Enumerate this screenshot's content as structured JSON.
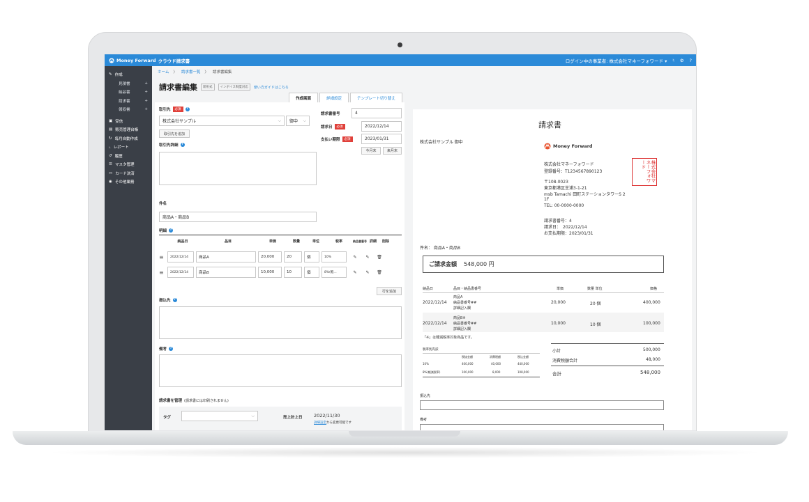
{
  "app": {
    "brand": "Money Forward",
    "product": "クラウド請求書",
    "login_user": "ログイン中の事業者: 株式会社マネーフォワード ▾"
  },
  "sidebar": {
    "create": "作成",
    "subs": [
      "見積書",
      "納品書",
      "請求書",
      "領収書"
    ],
    "items": [
      "受信",
      "販売管理台帳",
      "毎月自動作成",
      "レポート",
      "履歴",
      "マスタ管理",
      "カード決済",
      "その他業務"
    ]
  },
  "breadcrumb": [
    "ホーム",
    "請求書一覧",
    "請求書編集"
  ],
  "page": {
    "title": "請求書編集",
    "tag1": "新形式",
    "tag2": "インボイス制度対応",
    "guide": "使い方ガイドはこちら"
  },
  "tabs": [
    "作成画面",
    "詳細設定",
    "テンプレート切り替え"
  ],
  "form": {
    "customer_label": "取引先",
    "required": "必須",
    "customer_value": "株式会社サンプル",
    "honorific": "御中",
    "add_customer": "取引先を追加",
    "customer_detail_label": "取引先詳細",
    "invoice_no_label": "請求書番号",
    "invoice_no": "4",
    "date_label": "請求日",
    "date": "2022/12/14",
    "due_label": "支払い期限",
    "due": "2023/01/31",
    "this_month_end": "今月末",
    "next_month_end": "来月末",
    "subject_label": "件名",
    "subject": "商品A・商品B",
    "details_label": "明細",
    "bank_label": "振込先",
    "memo_label": "備考",
    "add_row": "行を追加",
    "manage_label": "請求書を管理",
    "manage_note": "(請求書には印刷されません)",
    "tag_label": "タグ",
    "sales_date_label": "売上計上日",
    "sales_date": "2022/11/30",
    "sales_note_link": "詳細設定",
    "sales_note": "から変更可能です"
  },
  "table": {
    "headers": [
      "納品日",
      "品目",
      "単価",
      "数量",
      "単位",
      "税率",
      "納品書番号",
      "詳細",
      "削除"
    ],
    "rows": [
      {
        "date": "2022/12/14",
        "item": "商品A",
        "price": "20,000",
        "qty": "20",
        "unit": "個",
        "tax": "10%"
      },
      {
        "date": "2022/12/14",
        "item": "商品B",
        "price": "10,000",
        "qty": "10",
        "unit": "個",
        "tax": "8%(軽..."
      }
    ]
  },
  "preview": {
    "title": "請求書",
    "to": "株式会社サンプル 御中",
    "company": "株式会社マネーフォワード",
    "reg_no": "登録番号：T1234567890123",
    "zip": "〒108-0023",
    "address1": "東京都港区芝浦3-1-21",
    "address2": "msb Tamachi 田町ステーションタワーS 2",
    "address3": "1F",
    "tel": "TEL: 00-0000-0000",
    "inv_no": "請求書番号：4",
    "inv_date": "請求日：　2022/12/14",
    "inv_due": "お支払期限：2023/01/31",
    "seal": "株式会社マネーフォワード",
    "subject": "件名：  商品A・商品B",
    "amount_label": "ご請求金額",
    "amount": "548,000 円",
    "cols": [
      "納品日",
      "品目・納品書番号",
      "単価",
      "数量 単位",
      "価格"
    ],
    "items": [
      {
        "date": "2022/12/14",
        "name": "商品A",
        "sub1": "納品書番号##",
        "sub2": "詳細記入欄",
        "price": "20,000",
        "qty": "20 個",
        "total": "400,000"
      },
      {
        "date": "2022/12/14",
        "name": "商品B※",
        "sub1": "納品書番号##",
        "sub2": "詳細記入欄",
        "price": "10,000",
        "qty": "10 個",
        "total": "100,000"
      }
    ],
    "reduced_note": "「※」は軽減税率対象商品です。",
    "tax_breakdown": "税率別内訳",
    "tax_cols": [
      "税抜金額",
      "消費税額",
      "税込金額"
    ],
    "tax_rows": [
      [
        "10%",
        "400,000",
        "40,000",
        "440,000"
      ],
      [
        "8%(軽減税率)",
        "100,000",
        "8,000",
        "108,000"
      ]
    ],
    "subtotal_label": "小計",
    "subtotal": "500,000",
    "tax_label": "消費税額合計",
    "tax": "48,000",
    "total_label": "合計",
    "total": "548,000",
    "bank_label": "振込先",
    "memo_label": "備考"
  },
  "colors": {
    "topbar": "#2b8ad8",
    "sidebar": "#3a3f47",
    "required": "#e0403a"
  }
}
